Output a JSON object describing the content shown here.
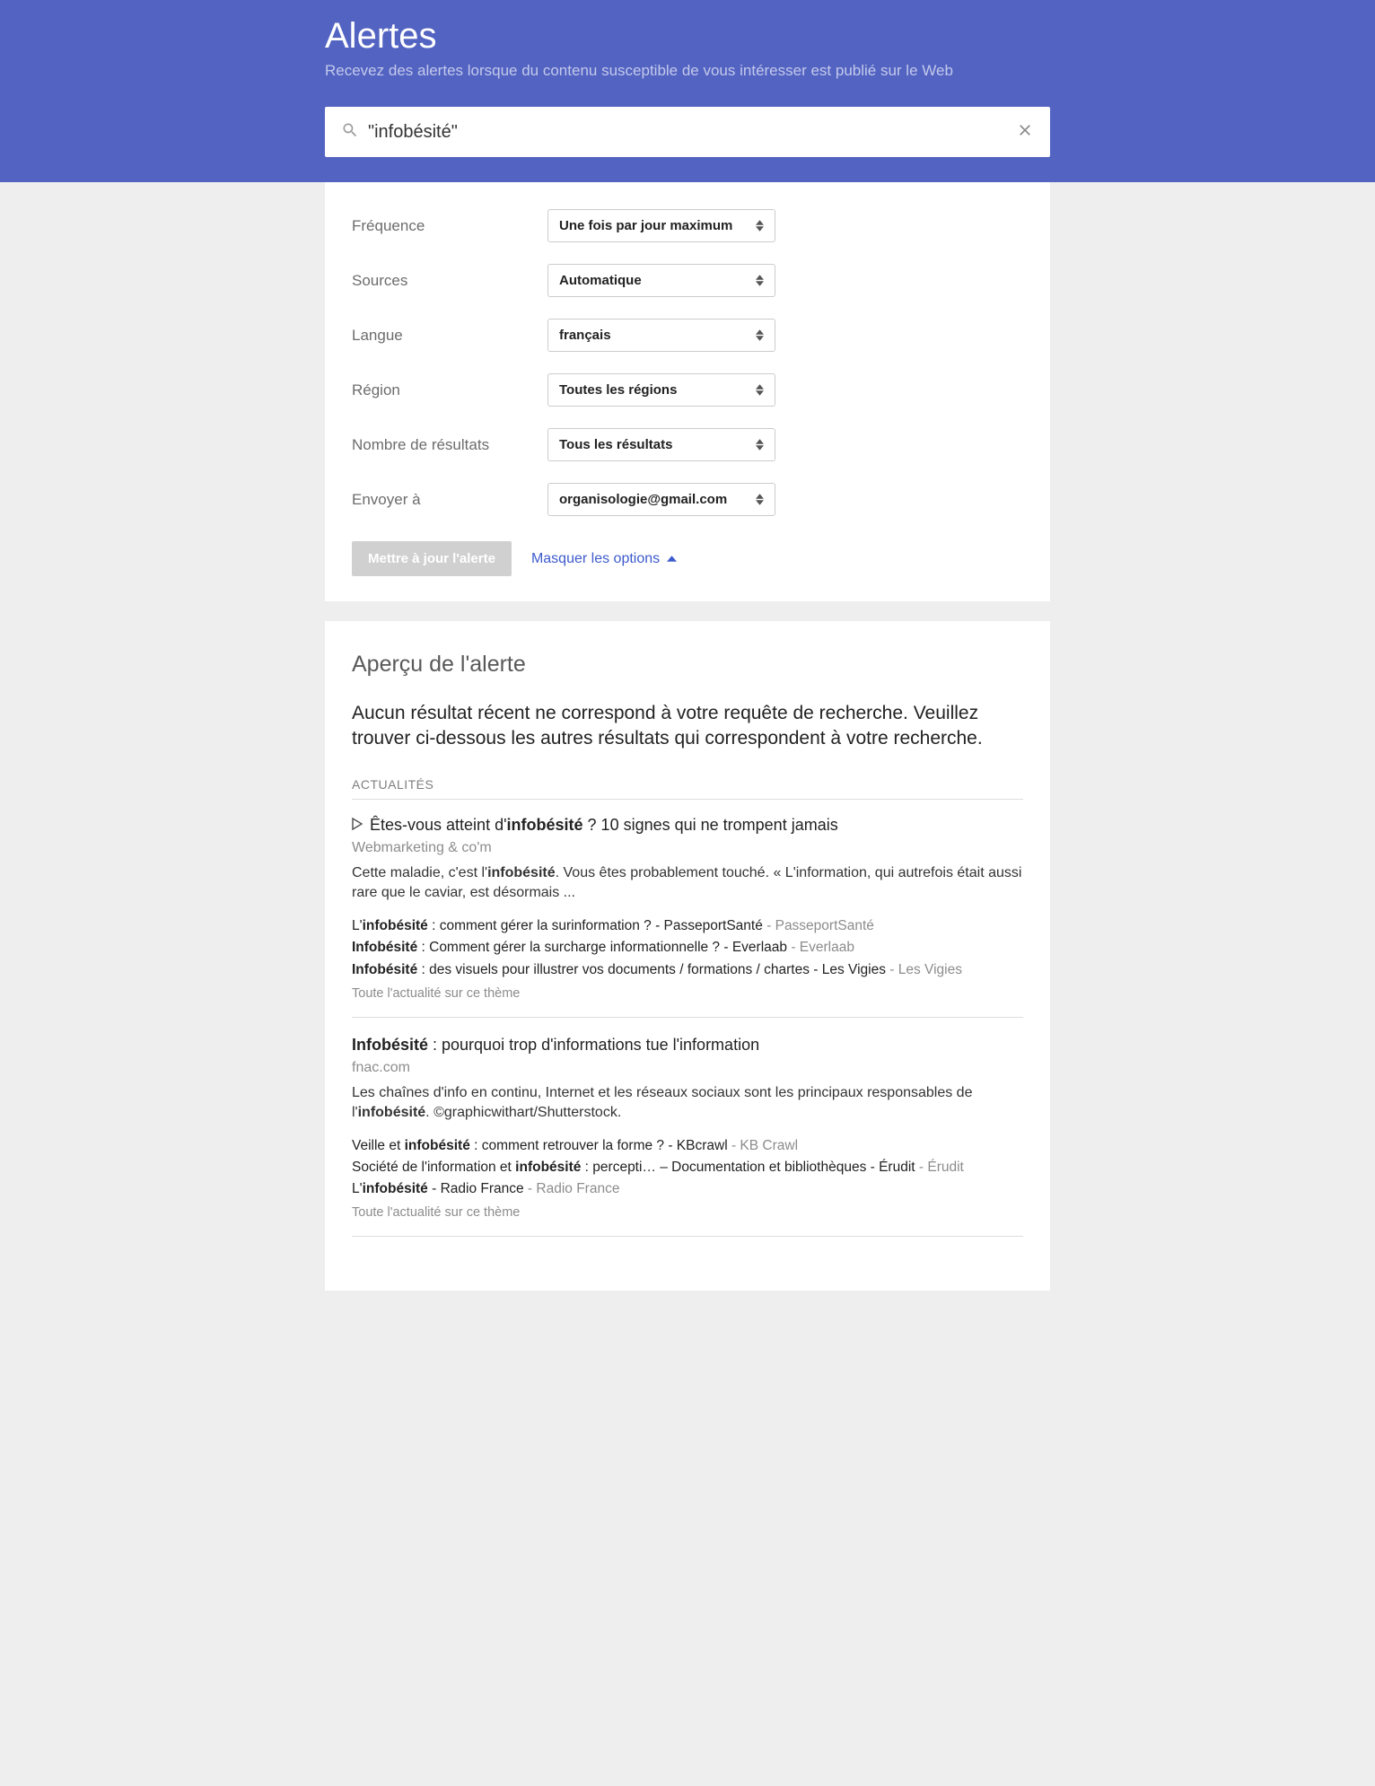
{
  "header": {
    "title": "Alertes",
    "subtitle": "Recevez des alertes lorsque du contenu susceptible de vous intéresser est publié sur le Web"
  },
  "search": {
    "value": "\"infobésité\""
  },
  "options": {
    "frequency": {
      "label": "Fréquence",
      "value": "Une fois par jour maximum"
    },
    "sources": {
      "label": "Sources",
      "value": "Automatique"
    },
    "language": {
      "label": "Langue",
      "value": "français"
    },
    "region": {
      "label": "Région",
      "value": "Toutes les régions"
    },
    "num_results": {
      "label": "Nombre de résultats",
      "value": "Tous les résultats"
    },
    "send_to": {
      "label": "Envoyer à",
      "value": "organisologie@gmail.com"
    }
  },
  "buttons": {
    "update": "Mettre à jour l'alerte",
    "hide_options": "Masquer les options"
  },
  "preview": {
    "title": "Aperçu de l'alerte",
    "message": "Aucun résultat récent ne correspond à votre requête de recherche. Veuillez trouver ci-dessous les autres résultats qui correspondent à votre recherche.",
    "section_label": "ACTUALITÉS",
    "results": [
      {
        "has_play": true,
        "title_pre": "Êtes-vous atteint d'",
        "title_bold": "infobésité",
        "title_post": " ? 10 signes qui ne trompent jamais",
        "source": "Webmarketing & co'm",
        "snippet_pre": "Cette maladie, c'est l'",
        "snippet_bold": "infobésité",
        "snippet_post": ". Vous êtes probablement touché. « L'information, qui autrefois était aussi rare que le caviar, est désormais ...",
        "related": [
          {
            "pre": "L'",
            "bold": "infobésité",
            "post": " : comment gérer la surinformation ? - PasseportSanté",
            "src": " - PasseportSanté"
          },
          {
            "pre": "",
            "bold": "Infobésité",
            "post": " : Comment gérer la surcharge informationnelle ? - Everlaab",
            "src": " - Everlaab"
          },
          {
            "pre": "",
            "bold": "Infobésité",
            "post": " : des visuels pour illustrer vos documents / formations / chartes - Les Vigies",
            "src": " - Les Vigies"
          }
        ],
        "more": "Toute l'actualité sur ce thème"
      },
      {
        "has_play": false,
        "title_pre": "",
        "title_bold": "Infobésité",
        "title_post": " : pourquoi trop d'informations tue l'information",
        "source": "fnac.com",
        "snippet_pre": "Les chaînes d'info en continu, Internet et les réseaux sociaux sont les principaux responsables de l'",
        "snippet_bold": "infobésité",
        "snippet_post": ". ©graphicwithart/Shutterstock.",
        "related": [
          {
            "pre": "Veille et ",
            "bold": "infobésité",
            "post": " : comment retrouver la forme ? - KBcrawl",
            "src": " - KB Crawl"
          },
          {
            "pre": "Société de l'information et ",
            "bold": "infobésité",
            "post": " : percepti… – Documentation et bibliothèques - Érudit",
            "src": " - Érudit"
          },
          {
            "pre": "L'",
            "bold": "infobésité",
            "post": " - Radio France",
            "src": " - Radio France"
          }
        ],
        "more": "Toute l'actualité sur ce thème"
      }
    ]
  }
}
